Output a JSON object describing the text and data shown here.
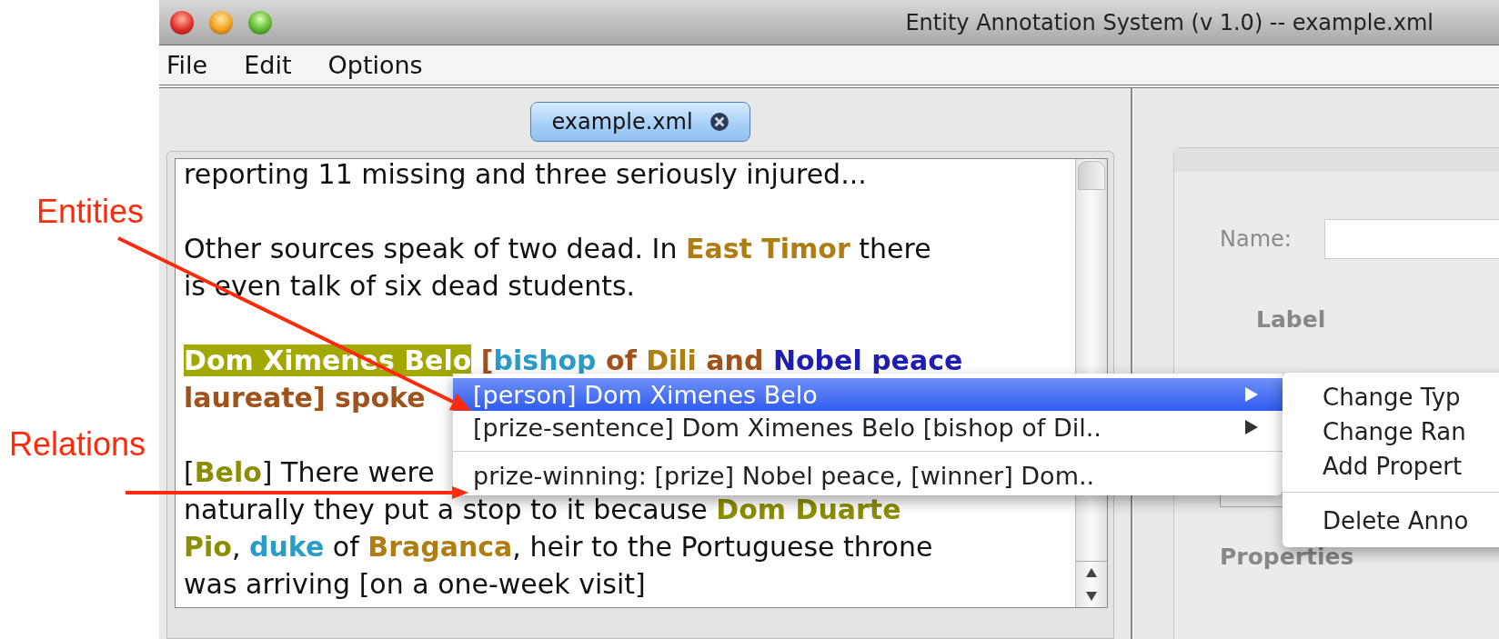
{
  "window": {
    "title": "Entity Annotation System (v 1.0) -- example.xml"
  },
  "menu_bar": [
    "File",
    "Edit",
    "Options"
  ],
  "tabs": [
    {
      "label": "example.xml",
      "selected": true,
      "closable": true
    }
  ],
  "document": {
    "paragraphs": [
      {
        "lines": [
          [
            {
              "text": "reporting 11 missing and three seriously injured...",
              "kind": "plain",
              "selected": false
            }
          ]
        ]
      },
      {
        "lines": [
          [
            {
              "text": "Other sources speak of two dead. In ",
              "kind": "plain",
              "selected": false
            },
            {
              "text": "East Timor",
              "kind": "location",
              "selected": false
            },
            {
              "text": " there",
              "kind": "plain",
              "selected": false
            }
          ],
          [
            {
              "text": "is even talk of six dead students.",
              "kind": "plain",
              "selected": false
            }
          ]
        ]
      },
      {
        "lines": [
          [
            {
              "text": "Dom Ximenes Belo",
              "kind": "person",
              "selected": true
            },
            {
              "text": " [",
              "kind": "sentence",
              "selected": false
            },
            {
              "text": "bishop",
              "kind": "role",
              "selected": false
            },
            {
              "text": " of ",
              "kind": "sentence",
              "selected": false
            },
            {
              "text": "Dili",
              "kind": "location",
              "selected": false
            },
            {
              "text": " and ",
              "kind": "sentence",
              "selected": false
            },
            {
              "text": "Nobel peace",
              "kind": "prize",
              "selected": false
            }
          ],
          [
            {
              "text": "laureate] spoke",
              "kind": "sentence",
              "selected": false
            }
          ]
        ]
      },
      {
        "lines": [
          [
            {
              "text": "[",
              "kind": "plain",
              "selected": false
            },
            {
              "text": "Belo",
              "kind": "person",
              "selected": false
            },
            {
              "text": "] There were",
              "kind": "plain",
              "selected": false
            }
          ],
          [
            {
              "text": "naturally they put a stop to it because ",
              "kind": "plain",
              "selected": false
            },
            {
              "text": "Dom Duarte",
              "kind": "person",
              "selected": false
            }
          ],
          [
            {
              "text": "Pio",
              "kind": "person",
              "selected": false
            },
            {
              "text": ", ",
              "kind": "plain",
              "selected": false
            },
            {
              "text": "duke",
              "kind": "role",
              "selected": false
            },
            {
              "text": " of ",
              "kind": "plain",
              "selected": false
            },
            {
              "text": "Braganca",
              "kind": "location",
              "selected": false
            },
            {
              "text": ", heir to the Portuguese throne",
              "kind": "plain",
              "selected": false
            }
          ],
          [
            {
              "text": "was arriving [on a one-week visit]",
              "kind": "plain",
              "selected": false
            }
          ]
        ]
      }
    ]
  },
  "details": {
    "name_label": "Name:",
    "label_heading": "Label",
    "properties_heading": "Properties"
  },
  "context_menu": {
    "groups": [
      [
        {
          "label": "[person] Dom Ximenes Belo",
          "selected": true,
          "submenu": true
        },
        {
          "label": "[prize-sentence] Dom Ximenes Belo [bishop of Dil..",
          "selected": false,
          "submenu": true
        }
      ],
      [
        {
          "label": "prize-winning: [prize] Nobel peace, [winner] Dom..",
          "selected": false,
          "submenu": false
        }
      ]
    ]
  },
  "submenu": {
    "groups": [
      [
        "Change Typ",
        "Change Ran",
        "Add Propert"
      ],
      [
        "Delete Anno"
      ]
    ]
  },
  "annotations": [
    {
      "label": "Entities"
    },
    {
      "label": "Relations"
    }
  ]
}
